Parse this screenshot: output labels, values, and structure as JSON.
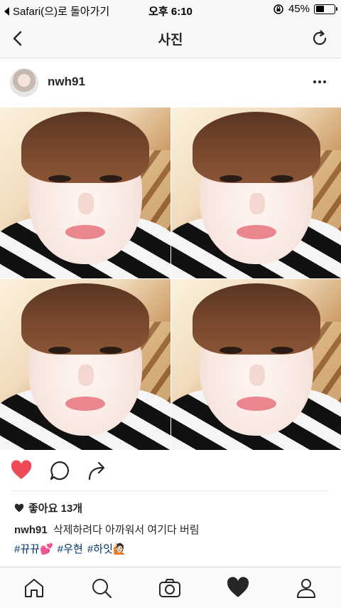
{
  "status_bar": {
    "back_app": "Safari(으)로 돌아가기",
    "time": "오후 6:10",
    "battery_percent": "45%",
    "battery_level": 0.45
  },
  "nav": {
    "title": "사진"
  },
  "post": {
    "username": "nwh91",
    "likes_text": "좋아요 13개",
    "caption_user": "nwh91",
    "caption_text": "삭제하려다 아까워서 여기다 버림",
    "hashtags": [
      "#뀨뀨💕",
      "#우현",
      "#하잇🙋🏻"
    ]
  },
  "colors": {
    "like_active": "#ed4956",
    "hashtag": "#003569",
    "text": "#262626"
  },
  "icons": {
    "back": "chevron-left-icon",
    "refresh": "refresh-icon",
    "more": "more-horizontal-icon",
    "like": "heart-filled-icon",
    "comment": "comment-icon",
    "share": "share-icon",
    "tab_home": "home-icon",
    "tab_search": "search-icon",
    "tab_camera": "camera-icon",
    "tab_activity": "heart-filled-icon",
    "tab_profile": "profile-icon"
  }
}
